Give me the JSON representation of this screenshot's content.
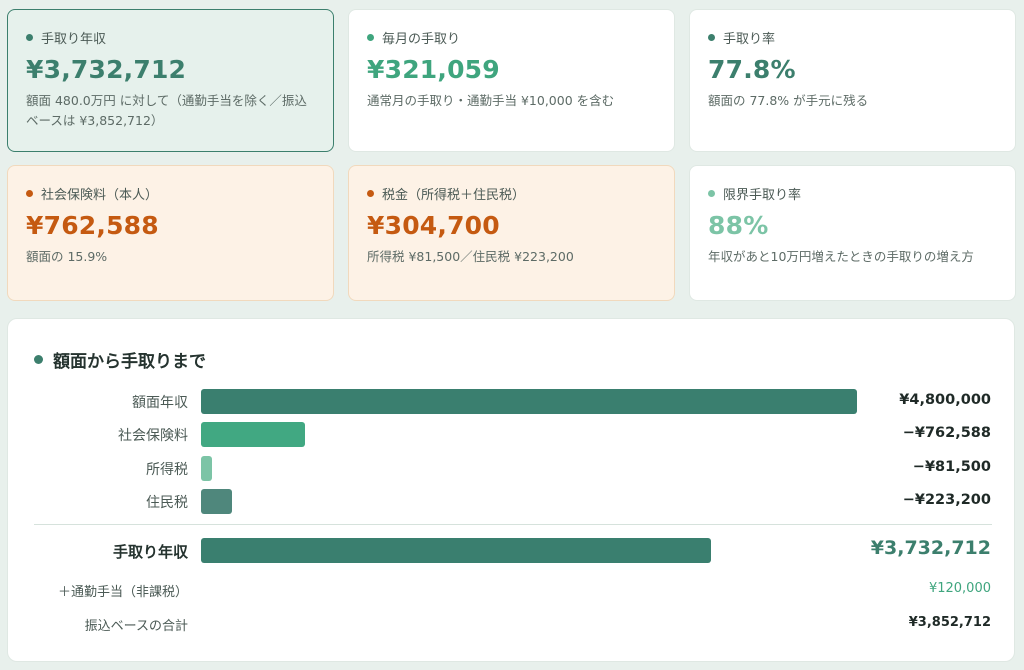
{
  "colors": {
    "primary": "#3c7f6d",
    "accent_green": "#3fa57e",
    "orange": "#c55a11",
    "light_green": "#7cc4a6",
    "highlight_bg": "#e6f1ec",
    "warn_bg": "#fdf2e6"
  },
  "cards": [
    {
      "label": "手取り年収",
      "value": "¥3,732,712",
      "sub": "額面 480.0万円 に対して（通勤手当を除く／振込ベースは ¥3,852,712）",
      "style": "highlight",
      "dot_color": "#3c7f6d",
      "value_color": "#3c7f6d"
    },
    {
      "label": "毎月の手取り",
      "value": "¥321,059",
      "sub": "通常月の手取り・通勤手当 ¥10,000 を含む",
      "style": "plain",
      "dot_color": "#3fa57e",
      "value_color": "#3fa57e"
    },
    {
      "label": "手取り率",
      "value": "77.8%",
      "sub": "額面の 77.8% が手元に残る",
      "style": "plain",
      "dot_color": "#3c7f6d",
      "value_color": "#3c7f6d"
    },
    {
      "label": "社会保険料（本人）",
      "value": "¥762,588",
      "sub": "額面の 15.9%",
      "style": "warn",
      "dot_color": "#c55a11",
      "value_color": "#c55a11"
    },
    {
      "label": "税金（所得税＋住民税）",
      "value": "¥304,700",
      "sub": "所得税 ¥81,500／住民税 ¥223,200",
      "style": "warn",
      "dot_color": "#c55a11",
      "value_color": "#c55a11"
    },
    {
      "label": "限界手取り率",
      "value": "88%",
      "sub": "年収があと10万円増えたときの手取りの増え方",
      "style": "plain",
      "dot_color": "#7cc4a6",
      "value_color": "#7cc4a6"
    }
  ],
  "breakdown": {
    "title": "額面から手取りまで",
    "rows": [
      {
        "label": "額面年収",
        "value": "¥4,800,000",
        "amount": 4800000,
        "color": "#3a7f6f"
      },
      {
        "label": "社会保険料",
        "value": "−¥762,588",
        "amount": 762588,
        "color": "#41a882"
      },
      {
        "label": "所得税",
        "value": "−¥81,500",
        "amount": 81500,
        "color": "#7cc4a6"
      },
      {
        "label": "住民税",
        "value": "−¥223,200",
        "amount": 223200,
        "color": "#4f877c"
      }
    ],
    "total": {
      "label": "手取り年収",
      "value": "¥3,732,712",
      "amount": 3732712,
      "color": "#3a7f6f"
    },
    "commute": {
      "label": "＋通勤手当（非課税）",
      "value": "¥120,000"
    },
    "transfer": {
      "label": "振込ベースの合計",
      "value": "¥3,852,712"
    }
  }
}
